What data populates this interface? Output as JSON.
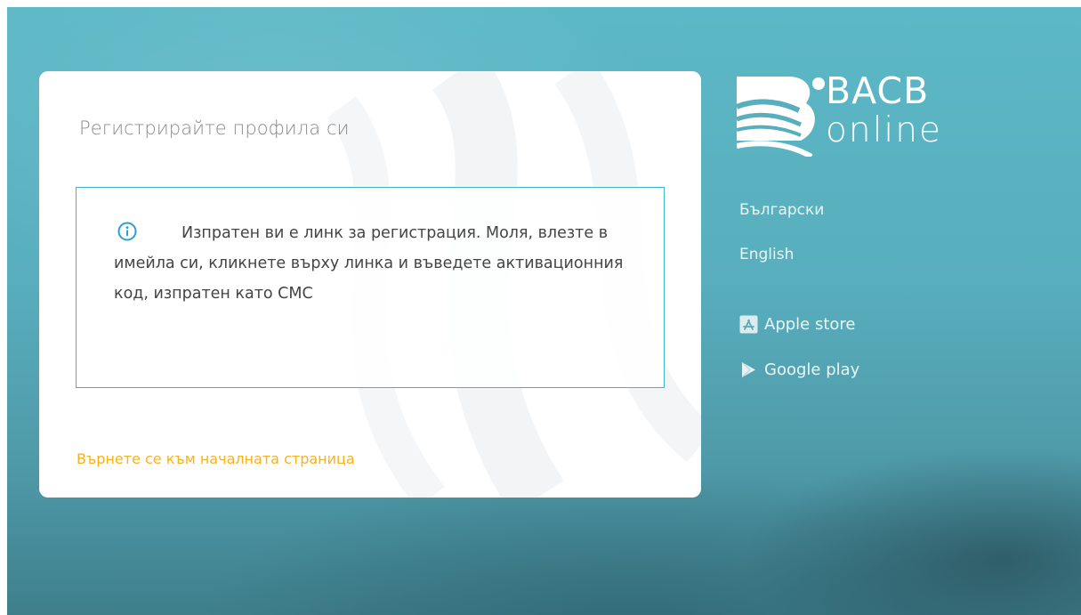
{
  "card": {
    "title": "Регистрирайте профила си",
    "info_message": "Изпратен ви е линк за регистрация. Моля, влезте в имейла си, кликнете върху линка и въведете активационния код, изпратен като СМС",
    "info_icon": "info-circle-icon",
    "back_link_label": "Върнете се към началната страница"
  },
  "brand": {
    "name_line1": "BACB",
    "name_line2": "online"
  },
  "languages": [
    {
      "label": "Български"
    },
    {
      "label": "English"
    }
  ],
  "stores": [
    {
      "label": "Apple store",
      "icon": "app-store-icon"
    },
    {
      "label": "Google play",
      "icon": "google-play-icon"
    }
  ],
  "colors": {
    "accent_link": "#f6b11f",
    "info_border": "#3fb3d6",
    "background": "#58aebd"
  }
}
